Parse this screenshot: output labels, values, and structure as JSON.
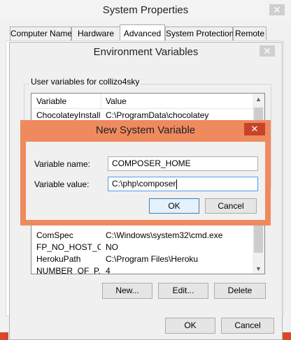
{
  "system_properties": {
    "title": "System Properties",
    "close_glyph": "✕",
    "tabs": [
      "Computer Name",
      "Hardware",
      "Advanced",
      "System Protection",
      "Remote"
    ]
  },
  "env_window": {
    "title": "Environment Variables",
    "close_glyph": "✕",
    "user_group_label": "User variables for collizo4sky",
    "columns": {
      "variable": "Variable",
      "value": "Value"
    },
    "user_rows": [
      {
        "variable": "ChocolateyInstall",
        "value": "C:\\ProgramData\\chocolatey"
      }
    ],
    "system_rows": [
      {
        "variable": "ComSpec",
        "value": "C:\\Windows\\system32\\cmd.exe"
      },
      {
        "variable": "FP_NO_HOST_C...",
        "value": "NO"
      },
      {
        "variable": "HerokuPath",
        "value": "C:\\Program Files\\Heroku"
      },
      {
        "variable": "NUMBER_OF_P...",
        "value": "4"
      }
    ],
    "buttons": {
      "new": "New...",
      "edit": "Edit...",
      "delete": "Delete",
      "ok": "OK",
      "cancel": "Cancel"
    }
  },
  "dialog": {
    "title": "New System Variable",
    "close_glyph": "✕",
    "name_label": "Variable name:",
    "name_value": "COMPOSER_HOME",
    "value_label": "Variable value:",
    "value_value": "C:\\php\\composer",
    "ok": "OK",
    "cancel": "Cancel",
    "accent": "#ef8a5f"
  },
  "icons": {
    "scroll_up": "▲",
    "scroll_down": "▼"
  }
}
